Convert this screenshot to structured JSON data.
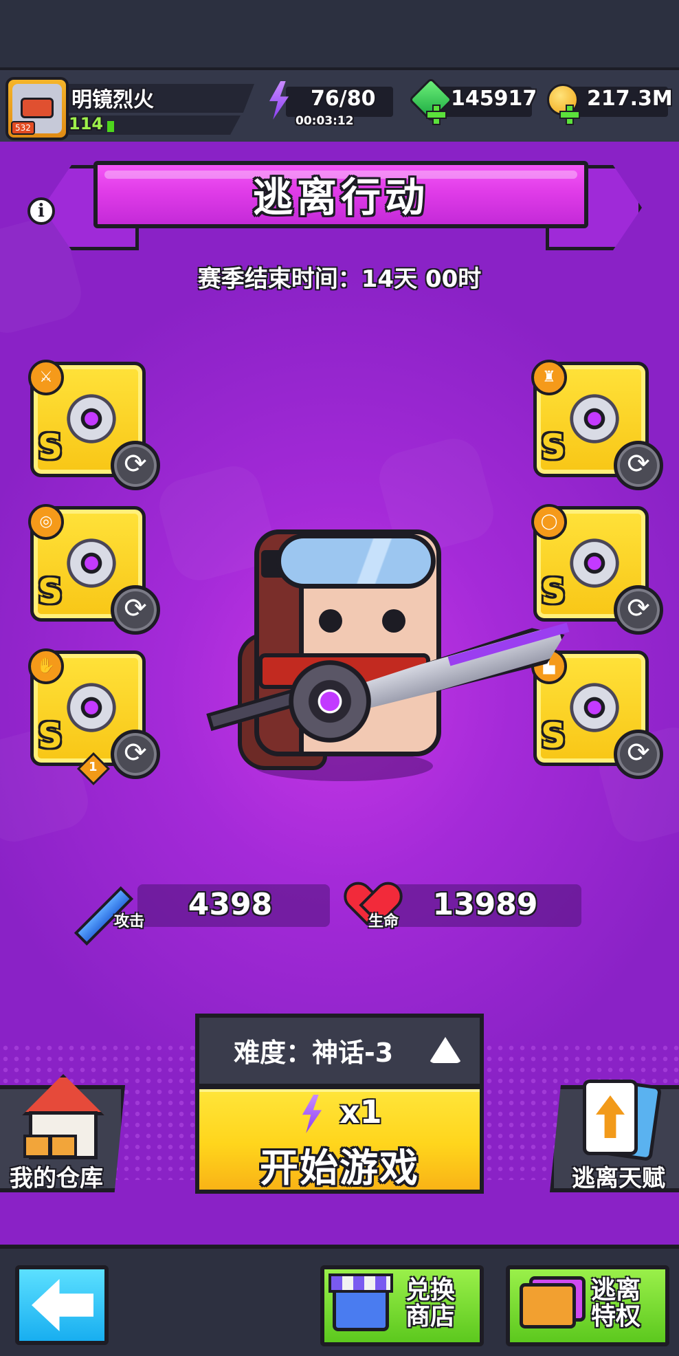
{
  "header": {
    "player_name": "明镜烈火",
    "level": "114",
    "avatar_level": "532",
    "energy": "76/80",
    "energy_timer": "00:03:12",
    "gems": "145917",
    "gold": "217.3M"
  },
  "title": {
    "text": "逃离行动",
    "info_icon": "i"
  },
  "season": {
    "end_time": "赛季结束时间：14天 00时"
  },
  "equipment": {
    "left": [
      {
        "slot": "weapon",
        "grade": "S",
        "icon": "sword-category-icon"
      },
      {
        "slot": "necklace",
        "grade": "S",
        "icon": "necklace-category-icon"
      },
      {
        "slot": "gloves",
        "grade": "S",
        "icon": "glove-category-icon",
        "badge": "1"
      }
    ],
    "right": [
      {
        "slot": "armor",
        "grade": "S",
        "icon": "armor-category-icon"
      },
      {
        "slot": "ring",
        "grade": "S",
        "icon": "ring-category-icon"
      },
      {
        "slot": "boots",
        "grade": "S",
        "icon": "boot-category-icon"
      }
    ]
  },
  "stats": {
    "attack_label": "攻击",
    "attack_value": "4398",
    "hp_label": "生命",
    "hp_value": "13989"
  },
  "difficulty": {
    "text": "难度：神话-3"
  },
  "start": {
    "cost": "x1",
    "label": "开始游戏"
  },
  "side": {
    "warehouse": "我的仓库",
    "talent": "逃离天赋"
  },
  "bottom": {
    "shop_line1": "兑换",
    "shop_line2": "商店",
    "privilege_line1": "逃离",
    "privilege_line2": "特权"
  },
  "colors": {
    "background_purple": "#a42ad8",
    "banner_magenta": "#e03ce8",
    "start_yellow": "#ffd51c",
    "slot_yellow": "#f8c616",
    "button_green": "#5cc81e",
    "back_blue": "#18aef0"
  }
}
